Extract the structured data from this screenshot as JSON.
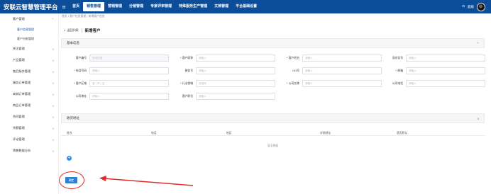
{
  "header": {
    "brand": "安联云智慧管理平台",
    "menu_icon": "hamburger-icon",
    "menu": [
      "首页",
      "销售管理",
      "营销管理",
      "分销管理",
      "专家评审管理",
      "特殊服务生产管理",
      "文档管理",
      "平台基础设置"
    ],
    "active_menu": "销售管理",
    "user_name": "超级"
  },
  "sidebar": {
    "items": [
      {
        "label": "客户管理",
        "chev": "^"
      },
      {
        "label": "客户信息管理",
        "sub": true,
        "active": true
      },
      {
        "label": "客户分配管理",
        "sub": true
      },
      {
        "label": "关注管理",
        "chev": "v"
      },
      {
        "label": "产品管理",
        "chev": "v"
      },
      {
        "label": "售后服务管理",
        "chev": "v"
      },
      {
        "label": "服务订单管理",
        "chev": "v"
      },
      {
        "label": "商城订单管理",
        "chev": "v"
      },
      {
        "label": "商品订单管理",
        "chev": "v"
      },
      {
        "label": "合同管理",
        "chev": "v"
      },
      {
        "label": "余额管理",
        "chev": "v"
      },
      {
        "label": "评论管理",
        "chev": "v"
      },
      {
        "label": "销售数据分析",
        "chev": "v"
      }
    ]
  },
  "breadcrumb": "首页 / 客户信息管理 / 新增客户信息",
  "back_label": "← 返回列表",
  "page_title": "新增客户",
  "basic_section": "基本信息",
  "form": {
    "rows": [
      [
        {
          "label": "客户编号",
          "required": false,
          "placeholder": "自动生成",
          "disabled": true
        },
        {
          "label": "客户昵称",
          "required": true,
          "placeholder": "请输入"
        },
        {
          "label": "客户姓名",
          "required": true,
          "placeholder": "请输入"
        },
        {
          "label": "身份证号",
          "required": false,
          "placeholder": "请输入"
        }
      ],
      [
        {
          "label": "电话号码",
          "required": true,
          "placeholder": "请输入"
        },
        {
          "label": "微信号",
          "required": false,
          "placeholder": "请输入"
        },
        {
          "label": "QQ号",
          "required": false,
          "placeholder": "请输入"
        },
        {
          "label": "邮箱",
          "required": true,
          "placeholder": "请输入"
        }
      ],
      [
        {
          "label": "客户区域",
          "required": true,
          "placeholder": "省 / 市 / 区",
          "select": true
        },
        {
          "label": "行业领域",
          "required": true,
          "placeholder": "请选择",
          "select": true
        },
        {
          "label": "公司名称",
          "required": true,
          "placeholder": "请输入"
        },
        {
          "label": "公司电话",
          "required": false,
          "placeholder": "请输入"
        }
      ],
      [
        {
          "label": "公司地址",
          "required": false,
          "placeholder": "请输入"
        },
        {
          "label": "客户职位",
          "required": false,
          "placeholder": "请输入"
        }
      ]
    ]
  },
  "address_section": "收货地址",
  "address_table": {
    "columns": [
      "姓名",
      "电话",
      "地区",
      "详细地址",
      "是否默认"
    ],
    "empty_text": "暂无数据",
    "add_icon": "+"
  },
  "confirm_label": "确定",
  "colors": {
    "brand": "#0b4d98",
    "accent": "#2f7fd4",
    "annotation": "#e02a2a"
  }
}
